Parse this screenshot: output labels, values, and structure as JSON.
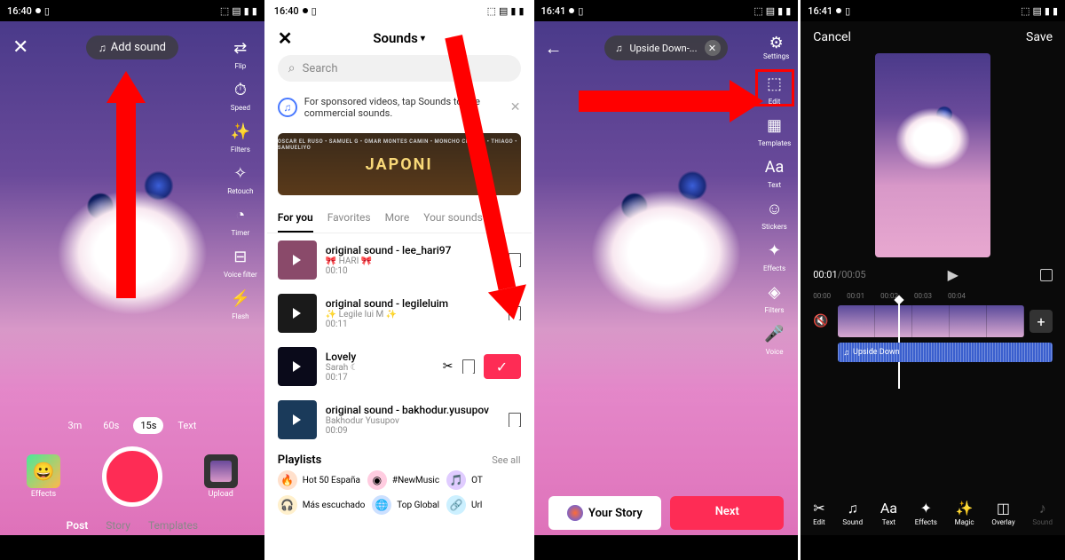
{
  "status": {
    "time1": "16:40",
    "time2": "16:40",
    "time3": "16:41",
    "time4": "16:41"
  },
  "screen1": {
    "add_sound": "Add sound",
    "side_tools": [
      {
        "icon": "⇄",
        "label": "Flip"
      },
      {
        "icon": "⏱",
        "label": "Speed"
      },
      {
        "icon": "✨",
        "label": "Filters"
      },
      {
        "icon": "✧",
        "label": "Retouch"
      },
      {
        "icon": "◔",
        "label": "Timer"
      },
      {
        "icon": "⊟",
        "label": "Voice filter"
      },
      {
        "icon": "⚡",
        "label": "Flash"
      }
    ],
    "durations": [
      {
        "label": "3m",
        "active": false
      },
      {
        "label": "60s",
        "active": false
      },
      {
        "label": "15s",
        "active": true
      },
      {
        "label": "Text",
        "active": false
      }
    ],
    "effects_label": "Effects",
    "upload_label": "Upload",
    "modes": [
      {
        "label": "Post",
        "active": true
      },
      {
        "label": "Story",
        "active": false
      },
      {
        "label": "Templates",
        "active": false
      }
    ]
  },
  "screen2": {
    "title": "Sounds",
    "search_placeholder": "Search",
    "sponsor_text": "For sponsored videos, tap Sounds to use commercial sounds.",
    "banner_artists": "OSCAR EL RUSO • SAMUEL G • OMAR MONTES    CAMIN • MONCHO CHAVEA • THIAGO • SAMUELIYO",
    "banner_title": "JAPONI",
    "tabs": [
      {
        "label": "For you",
        "active": true
      },
      {
        "label": "Favorites",
        "active": false
      },
      {
        "label": "More",
        "active": false
      },
      {
        "label": "Your sounds",
        "active": false
      }
    ],
    "sounds": [
      {
        "title": "original sound - lee_hari97",
        "artist": "🎀 HARI 🎀",
        "time": "00:10",
        "selected": false,
        "thumb_bg": "#8a4a6a"
      },
      {
        "title": "original sound - legileluim",
        "artist": "✨ Legile lui M ✨",
        "time": "00:11",
        "selected": false,
        "thumb_bg": "#1a1a1a"
      },
      {
        "title": "Lovely",
        "artist": "Sarah ☾",
        "time": "00:17",
        "selected": true,
        "thumb_bg": "#0a0a1a"
      },
      {
        "title": "original sound - bakhodur.yusupov",
        "artist": "Bakhodur Yusupov",
        "time": "00:09",
        "selected": false,
        "thumb_bg": "#1a3a5a"
      }
    ],
    "playlists_label": "Playlists",
    "see_all": "See all",
    "playlists_row1": [
      {
        "icon": "🔥",
        "class": "pi-fire",
        "label": "Hot 50 España"
      },
      {
        "icon": "◉",
        "class": "pi-new",
        "label": "#NewMusic"
      },
      {
        "icon": "🎵",
        "class": "pi-ot",
        "label": "OT"
      }
    ],
    "playlists_row2": [
      {
        "icon": "🎧",
        "class": "pi-listen",
        "label": "Más escuchado"
      },
      {
        "icon": "🌐",
        "class": "pi-globe",
        "label": "Top Global"
      },
      {
        "icon": "🔗",
        "class": "pi-url",
        "label": "Url"
      }
    ]
  },
  "screen3": {
    "sound_name": "Upside Down-...",
    "settings_label": "Settings",
    "side_tools": [
      {
        "icon": "⬚",
        "label": "Edit",
        "highlight": true
      },
      {
        "icon": "▦",
        "label": "Templates"
      },
      {
        "icon": "Aa",
        "label": "Text"
      },
      {
        "icon": "☺",
        "label": "Stickers"
      },
      {
        "icon": "✦",
        "label": "Effects"
      },
      {
        "icon": "◈",
        "label": "Filters"
      },
      {
        "icon": "🎤",
        "label": "Voice"
      }
    ],
    "story_btn": "Your Story",
    "next_btn": "Next"
  },
  "screen4": {
    "cancel": "Cancel",
    "save": "Save",
    "current_time": "00:01",
    "total_time": "/00:05",
    "ruler": [
      "00:00",
      "00:01",
      "00:02",
      "00:03",
      "00:04"
    ],
    "sound_track_label": "Upside Down",
    "tools": [
      {
        "icon": "✂",
        "label": "Edit"
      },
      {
        "icon": "♫",
        "label": "Sound"
      },
      {
        "icon": "Aa",
        "label": "Text"
      },
      {
        "icon": "✦",
        "label": "Effects"
      },
      {
        "icon": "✨",
        "label": "Magic"
      },
      {
        "icon": "◫",
        "label": "Overlay"
      },
      {
        "icon": "♪",
        "label": "Sound",
        "dim": true
      }
    ]
  }
}
